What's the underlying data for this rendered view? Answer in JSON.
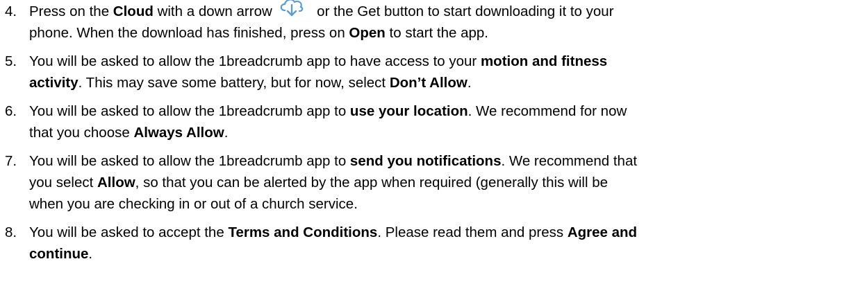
{
  "steps": [
    {
      "number": "4.",
      "lines": [
        [
          {
            "t": "Press on the "
          },
          {
            "t": "Cloud",
            "b": true
          },
          {
            "t": " with a down arrow "
          },
          {
            "icon": "cloud-download-icon"
          },
          {
            "t": " or the Get button to start downloading it to your"
          }
        ],
        [
          {
            "t": "phone. When the download has finished, press on "
          },
          {
            "t": "Open",
            "b": true
          },
          {
            "t": " to start the app."
          }
        ]
      ]
    },
    {
      "number": "5.",
      "lines": [
        [
          {
            "t": "You will be asked to allow the 1breadcrumb app to have access to your "
          },
          {
            "t": "motion and fitness",
            "b": true
          }
        ],
        [
          {
            "t": "activity",
            "b": true
          },
          {
            "t": ". This may save some battery, but for now, select "
          },
          {
            "t": "Don’t Allow",
            "b": true
          },
          {
            "t": "."
          }
        ]
      ]
    },
    {
      "number": "6.",
      "lines": [
        [
          {
            "t": "You will be asked to allow the 1breadcrumb app to "
          },
          {
            "t": "use your location",
            "b": true
          },
          {
            "t": ". We recommend for now"
          }
        ],
        [
          {
            "t": "that you choose "
          },
          {
            "t": "Always Allow",
            "b": true
          },
          {
            "t": "."
          }
        ]
      ]
    },
    {
      "number": "7.",
      "lines": [
        [
          {
            "t": "You will be asked to allow the 1breadcrumb app to "
          },
          {
            "t": "send you notifications",
            "b": true
          },
          {
            "t": ". We recommend that"
          }
        ],
        [
          {
            "t": "you select "
          },
          {
            "t": "Allow",
            "b": true
          },
          {
            "t": ", so that you can be alerted by the app when required (generally this will be"
          }
        ],
        [
          {
            "t": "when you are checking in or out of a church service."
          }
        ]
      ]
    },
    {
      "number": "8.",
      "lines": [
        [
          {
            "t": "You will be asked to accept the "
          },
          {
            "t": "Terms and Conditions",
            "b": true
          },
          {
            "t": ". Please read them and press "
          },
          {
            "t": "Agree and",
            "b": true
          }
        ],
        [
          {
            "t": "continue",
            "b": true
          },
          {
            "t": "."
          }
        ]
      ]
    }
  ],
  "colors": {
    "text": "#000000",
    "cloud_icon": "#5b9bd5"
  }
}
